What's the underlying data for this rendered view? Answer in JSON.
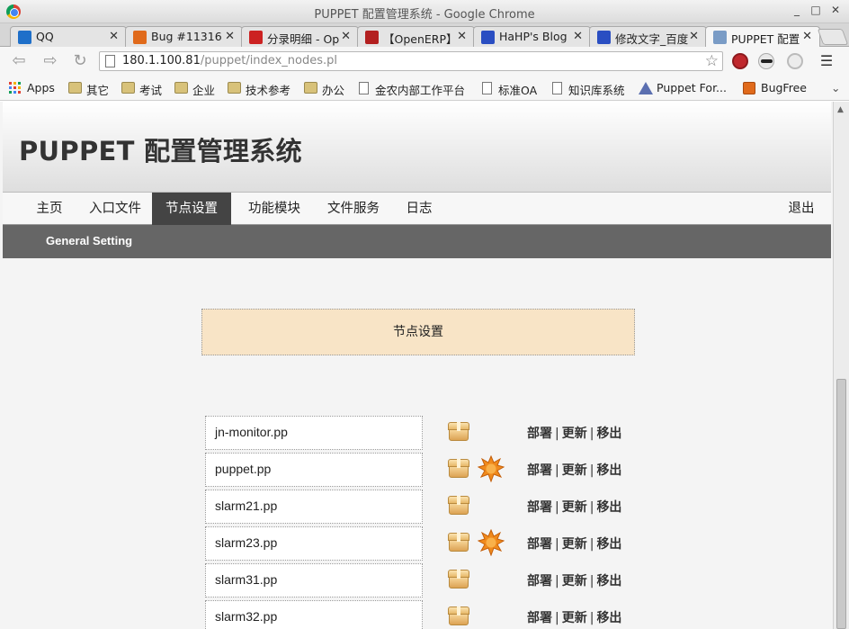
{
  "window": {
    "title": "PUPPET 配置管理系统 - Google Chrome",
    "min": "_",
    "max": "□",
    "close": "✕"
  },
  "tabs": [
    {
      "label": "QQ",
      "favicon_color": "#1e6fc9"
    },
    {
      "label": "Bug #11316",
      "favicon_color": "#e06a1b"
    },
    {
      "label": "分录明细 - Op",
      "favicon_color": "#cc2222"
    },
    {
      "label": "【OpenERP】",
      "favicon_color": "#b32020"
    },
    {
      "label": "HaHP's Blog",
      "favicon_color": "#2a4ec2"
    },
    {
      "label": "修改文字_百度",
      "favicon_color": "#2a4ec2"
    },
    {
      "label": "PUPPET 配置",
      "favicon_color": "#7a9cc6"
    }
  ],
  "toolbar": {
    "back": "⇦",
    "forward": "⇨",
    "reload": "↻",
    "url_host": "180.1.100.81",
    "url_path": "/puppet/index_nodes.pl",
    "star": "☆"
  },
  "bookmarks": [
    {
      "label": "Apps",
      "type": "apps"
    },
    {
      "label": "其它",
      "type": "folder"
    },
    {
      "label": "考试",
      "type": "folder"
    },
    {
      "label": "企业",
      "type": "folder"
    },
    {
      "label": "技术参考",
      "type": "folder"
    },
    {
      "label": "办公",
      "type": "folder"
    },
    {
      "label": "金农内部工作平台",
      "type": "page"
    },
    {
      "label": "标准OA",
      "type": "page"
    },
    {
      "label": "知识库系统",
      "type": "page"
    },
    {
      "label": "Puppet For...",
      "type": "puppet"
    },
    {
      "label": "BugFree",
      "type": "bugfree"
    }
  ],
  "bookmarks_more": "⌄",
  "site": {
    "title": "PUPPET 配置管理系统",
    "nav": [
      {
        "label": "主页",
        "active": false
      },
      {
        "label": "入口文件",
        "active": false
      },
      {
        "label": "节点设置",
        "active": true
      },
      {
        "label": "功能模块",
        "active": false
      },
      {
        "label": "文件服务",
        "active": false
      },
      {
        "label": "日志",
        "active": false
      }
    ],
    "logout": "退出",
    "subnav_link": "General Setting",
    "section_title": "节点设置",
    "nodes": [
      {
        "name": "jn-monitor.pp",
        "has_star": false
      },
      {
        "name": "puppet.pp",
        "has_star": true
      },
      {
        "name": "slarm21.pp",
        "has_star": false
      },
      {
        "name": "slarm23.pp",
        "has_star": true
      },
      {
        "name": "slarm31.pp",
        "has_star": false
      },
      {
        "name": "slarm32.pp",
        "has_star": false
      }
    ],
    "actions": {
      "deploy": "部署",
      "update": "更新",
      "remove": "移出",
      "separator": "|"
    }
  },
  "colors": {
    "accent_nav": "#444444",
    "subnav": "#666666",
    "section_bg": "#f8e4c6",
    "star": "#f08a1c"
  }
}
